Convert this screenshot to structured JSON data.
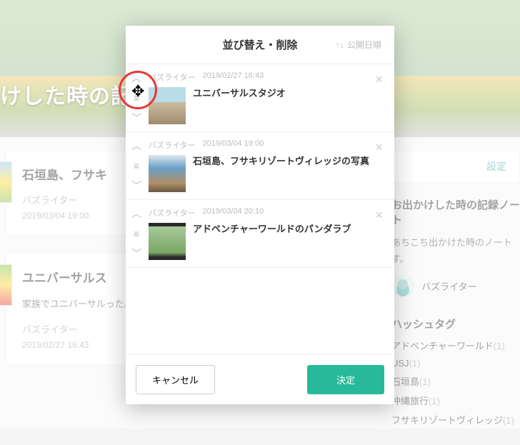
{
  "hero": {
    "title": "けした時の記録"
  },
  "cards": [
    {
      "title": "石垣島、フサキ",
      "desc": "",
      "author": "バズライター",
      "date": "2019/03/04 19:00"
    },
    {
      "title": "ユニバーサルス",
      "desc": "家族でユニバーサルった。また来たい。",
      "author": "バズライター",
      "date": "2019/02/27 16:43"
    }
  ],
  "settings_label": "設定",
  "about": {
    "heading": "お出かけした時の記録ノート",
    "text": "あちこち出かけた時のノートす。",
    "author": "バズライター"
  },
  "tags": {
    "heading": "ハッシュタグ",
    "items": [
      {
        "label": "アドベンチャーワールド",
        "count": "(1)"
      },
      {
        "label": "USJ",
        "count": "(1)"
      },
      {
        "label": "石垣島",
        "count": "(1)"
      },
      {
        "label": "沖縄旅行",
        "count": "(1)"
      },
      {
        "label": "フサキリゾートヴィレッジ",
        "count": "(1)"
      }
    ]
  },
  "modal": {
    "title": "並び替え・削除",
    "sort_label": "公開日順",
    "items": [
      {
        "author": "バズライター",
        "date": "2019/02/27 16:43",
        "title": "ユニバーサルスタジオ"
      },
      {
        "author": "バズライター",
        "date": "2019/03/04 19:00",
        "title": "石垣島、フサキリゾートヴィレッジの写真"
      },
      {
        "author": "バズライター",
        "date": "2019/03/04 20:10",
        "title": "アドベンチャーワールドのパンダラブ"
      }
    ],
    "cancel": "キャンセル",
    "confirm": "決定"
  }
}
